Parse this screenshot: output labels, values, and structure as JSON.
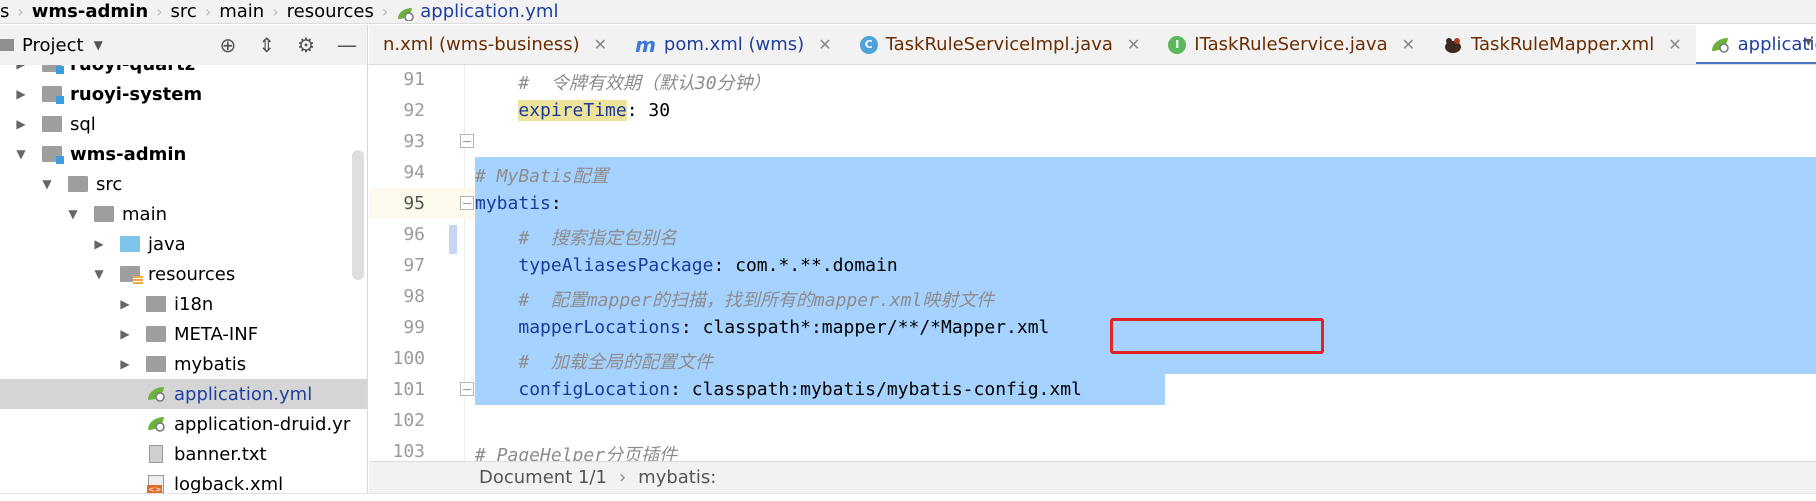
{
  "breadcrumb": {
    "items": [
      "s",
      "wms-admin",
      "src",
      "main",
      "resources",
      "application.yml"
    ]
  },
  "project_panel": {
    "title": "Project",
    "tools": [
      "target-icon",
      "collapse-icon",
      "gear-icon",
      "minimize-icon"
    ]
  },
  "tabs": [
    {
      "label": "n.xml (wms-business)",
      "icon": "xml-icon"
    },
    {
      "label": "pom.xml (wms)",
      "icon": "maven-icon"
    },
    {
      "label": "TaskRuleServiceImpl.java",
      "icon": "class-icon"
    },
    {
      "label": "ITaskRuleService.java",
      "icon": "interface-icon"
    },
    {
      "label": "TaskRuleMapper.xml",
      "icon": "mybatis-icon"
    },
    {
      "label": "application.yml",
      "icon": "spring-yml-icon",
      "active": true
    }
  ],
  "tree": [
    {
      "label": "ruoyi-quartz",
      "type": "module",
      "bold": true
    },
    {
      "label": "ruoyi-system",
      "type": "module",
      "bold": true
    },
    {
      "label": "sql",
      "type": "folder"
    },
    {
      "label": "wms-admin",
      "type": "module",
      "bold": true
    },
    {
      "label": "src",
      "type": "folder"
    },
    {
      "label": "main",
      "type": "folder"
    },
    {
      "label": "java",
      "type": "source-folder"
    },
    {
      "label": "resources",
      "type": "resources-folder"
    },
    {
      "label": "i18n",
      "type": "folder"
    },
    {
      "label": "META-INF",
      "type": "folder"
    },
    {
      "label": "mybatis",
      "type": "folder"
    },
    {
      "label": "application.yml",
      "type": "yml",
      "selected": true
    },
    {
      "label": "application-druid.yr",
      "type": "yml"
    },
    {
      "label": "banner.txt",
      "type": "txt"
    },
    {
      "label": "logback.xml",
      "type": "xml"
    }
  ],
  "editor": {
    "lines": [
      {
        "n": "91",
        "comment": "#  令牌有效期（默认30分钟）"
      },
      {
        "n": "92",
        "key": "expireTime",
        "value": " 30"
      },
      {
        "n": "93"
      },
      {
        "n": "94",
        "comment": "# MyBatis配置"
      },
      {
        "n": "95",
        "key": "mybatis",
        "value": ""
      },
      {
        "n": "96",
        "comment": "#  搜索指定包别名"
      },
      {
        "n": "97",
        "key": "typeAliasesPackage",
        "value": " com.*.**.domain"
      },
      {
        "n": "98",
        "comment": "#  配置mapper的扫描，找到所有的mapper.xml映射文件"
      },
      {
        "n": "99",
        "key": "mapperLocations",
        "value": " classpath*:mapper/**/*Mapper.xml"
      },
      {
        "n": "100",
        "comment": "#  加载全局的配置文件"
      },
      {
        "n": "101",
        "key": "configLocation",
        "value": " classpath:mybatis/mybatis-config.xml"
      },
      {
        "n": "102"
      },
      {
        "n": "103",
        "comment": "# PageHelper分页插件"
      }
    ]
  },
  "status_bar": {
    "document": "Document 1/1",
    "path": "mybatis:"
  },
  "colors": {
    "selection": "#a6d2ff",
    "highlight_box": "#e42020",
    "key": "#1a3a9c"
  }
}
